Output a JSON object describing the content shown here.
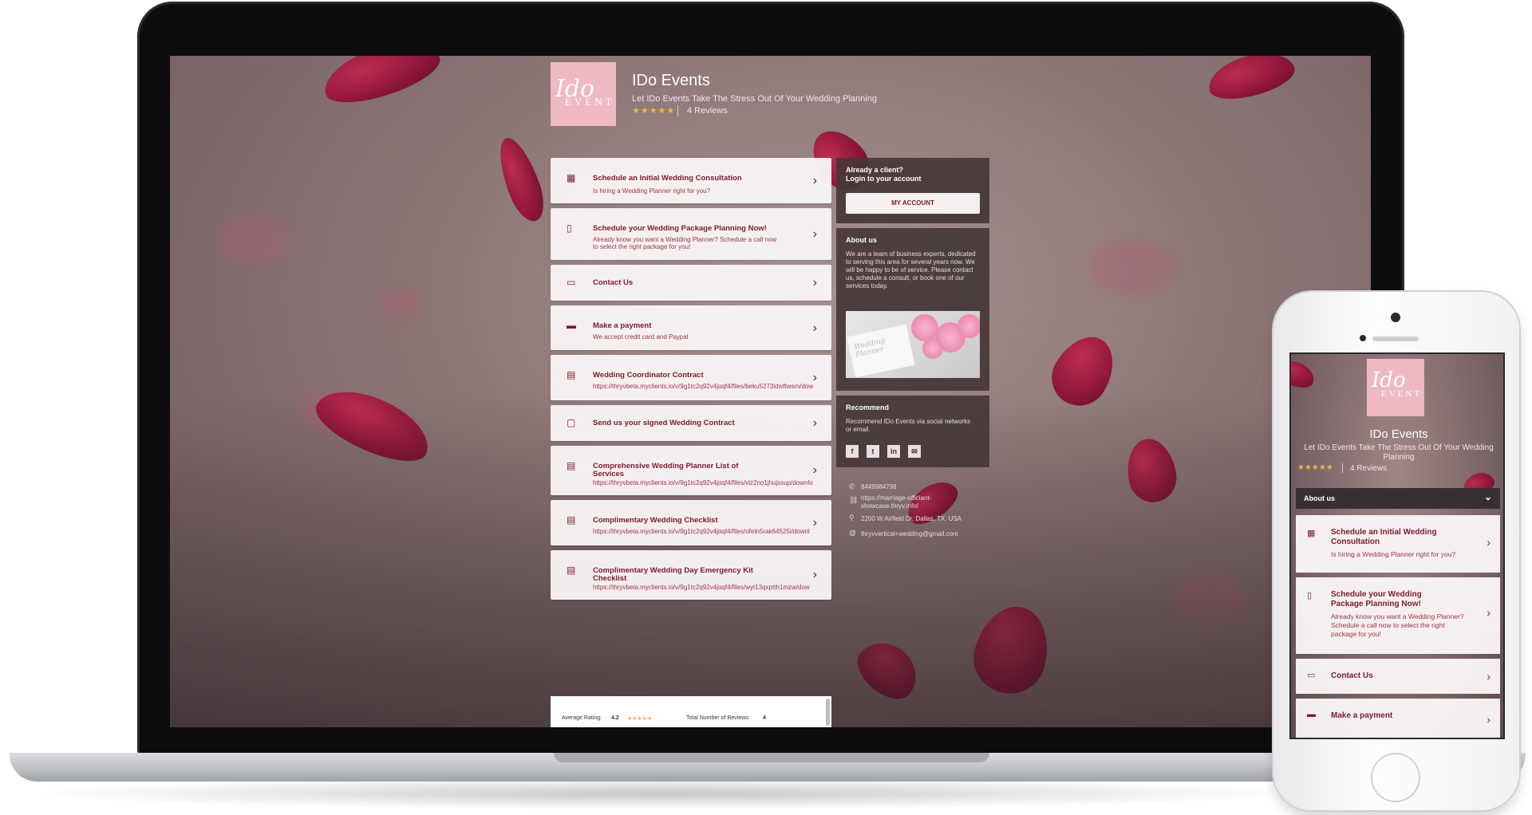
{
  "brand": {
    "logo_script": "Ido",
    "logo_caps": "EVENT",
    "title": "IDo Events",
    "tagline": "Let IDo Events Take The Stress Out Of Your Wedding Planning",
    "stars": "★★★★★",
    "reviews": "4 Reviews"
  },
  "services": [
    {
      "title": "Schedule an Initial Wedding Consultation",
      "subtitle": "Is hiring a Wedding Planner right for you?",
      "icon": "calendar-icon"
    },
    {
      "title": "Schedule your Wedding Package Planning Now!",
      "subtitle_lines": [
        "Already know you want a Wedding Planner? Schedule a call now",
        "to select the right package for you!"
      ],
      "icon": "tablet-icon"
    },
    {
      "title": "Contact Us",
      "icon": "laptop-icon"
    },
    {
      "title": "Make a payment",
      "subtitle": "We accept credit card and Paypal",
      "icon": "credit-card-icon"
    },
    {
      "title": "Wedding Coordinator Contract",
      "subtitle": "https://thryvbeta.myclients.io/v/9g1tc2q92v4joqf4/files/beku5273idwftwsm/dow",
      "icon": "document-icon"
    },
    {
      "title": "Send us your signed Wedding Contract",
      "icon": "file-icon"
    },
    {
      "title_lines": [
        "Comprehensive Wedding Planner List of",
        "Services"
      ],
      "subtitle": "https://thryvbeta.myclients.io/v/9g1tc2q92v4joqf4/files/vlz2no1jhujxsup/downlo",
      "icon": "document-icon"
    },
    {
      "title": "Complimentary Wedding Checklist",
      "subtitle": "https://thryvbeta.myclients.io/v/9g1tc2q92v4joqf4/files/ofetn5rak64525i/downl",
      "icon": "document-icon"
    },
    {
      "title_lines": [
        "Complimentary Wedding Day Emergency Kit",
        "Checklist"
      ],
      "subtitle": "https://thryvbeta.myclients.io/v/9g1tc2q92v4joqf4/files/wyt13qxptth1mzw/dow",
      "icon": "document-icon"
    }
  ],
  "account": {
    "heading_1": "Already a client?",
    "heading_2": "Login to your account",
    "button": "MY ACCOUNT"
  },
  "about": {
    "heading": "About us",
    "lines": [
      "We are a team of business experts, dedicated",
      "to serving this area for several years now. We",
      "will be happy to be of service. Please contact",
      "us, schedule a consult, or book one of our",
      "services today."
    ],
    "photo_caption": "Wedding Planner"
  },
  "recommend": {
    "heading": "Recommend",
    "lines": [
      "Recommend IDo Events via social networks",
      "or email."
    ],
    "social": [
      "f",
      "t",
      "in",
      "✉"
    ]
  },
  "contact": {
    "phone": "8449984798",
    "website_1": "https://marriage-officiant-",
    "website_2": "showcase.thryv.info/",
    "address": "2200 W Airfield Dr, Dallas, TX, USA",
    "email": "thryvvertical+wedding@gmail.com"
  },
  "rating": {
    "avg_label": "Average Rating:",
    "avg_value": "4.2",
    "avg_value_num": 4.2,
    "stars": "★★★★★",
    "total_label": "Total Number of Reviews:",
    "total_value": "4"
  },
  "phone": {
    "about_label": "About us",
    "cards": [
      {
        "title_lines": [
          "Schedule an Initial Wedding",
          "Consultation"
        ],
        "subtitle_lines": [
          "Is hiring a Wedding Planner right for you?"
        ]
      },
      {
        "title_lines": [
          "Schedule your Wedding",
          "Package Planning Now!"
        ],
        "subtitle_lines": [
          "Already know you want a Wedding Planner?",
          "Schedule a call now to select the right",
          "package for you!"
        ]
      },
      {
        "title_lines": [
          "Contact Us"
        ],
        "subtitle_lines": []
      },
      {
        "title_lines": [
          "Make a payment"
        ],
        "subtitle_lines": []
      }
    ]
  },
  "colors": {
    "accent": "#7a1a2e",
    "logo_bg": "#efb9c4",
    "star": "#f0b34c",
    "panel_bg": "#463737"
  }
}
